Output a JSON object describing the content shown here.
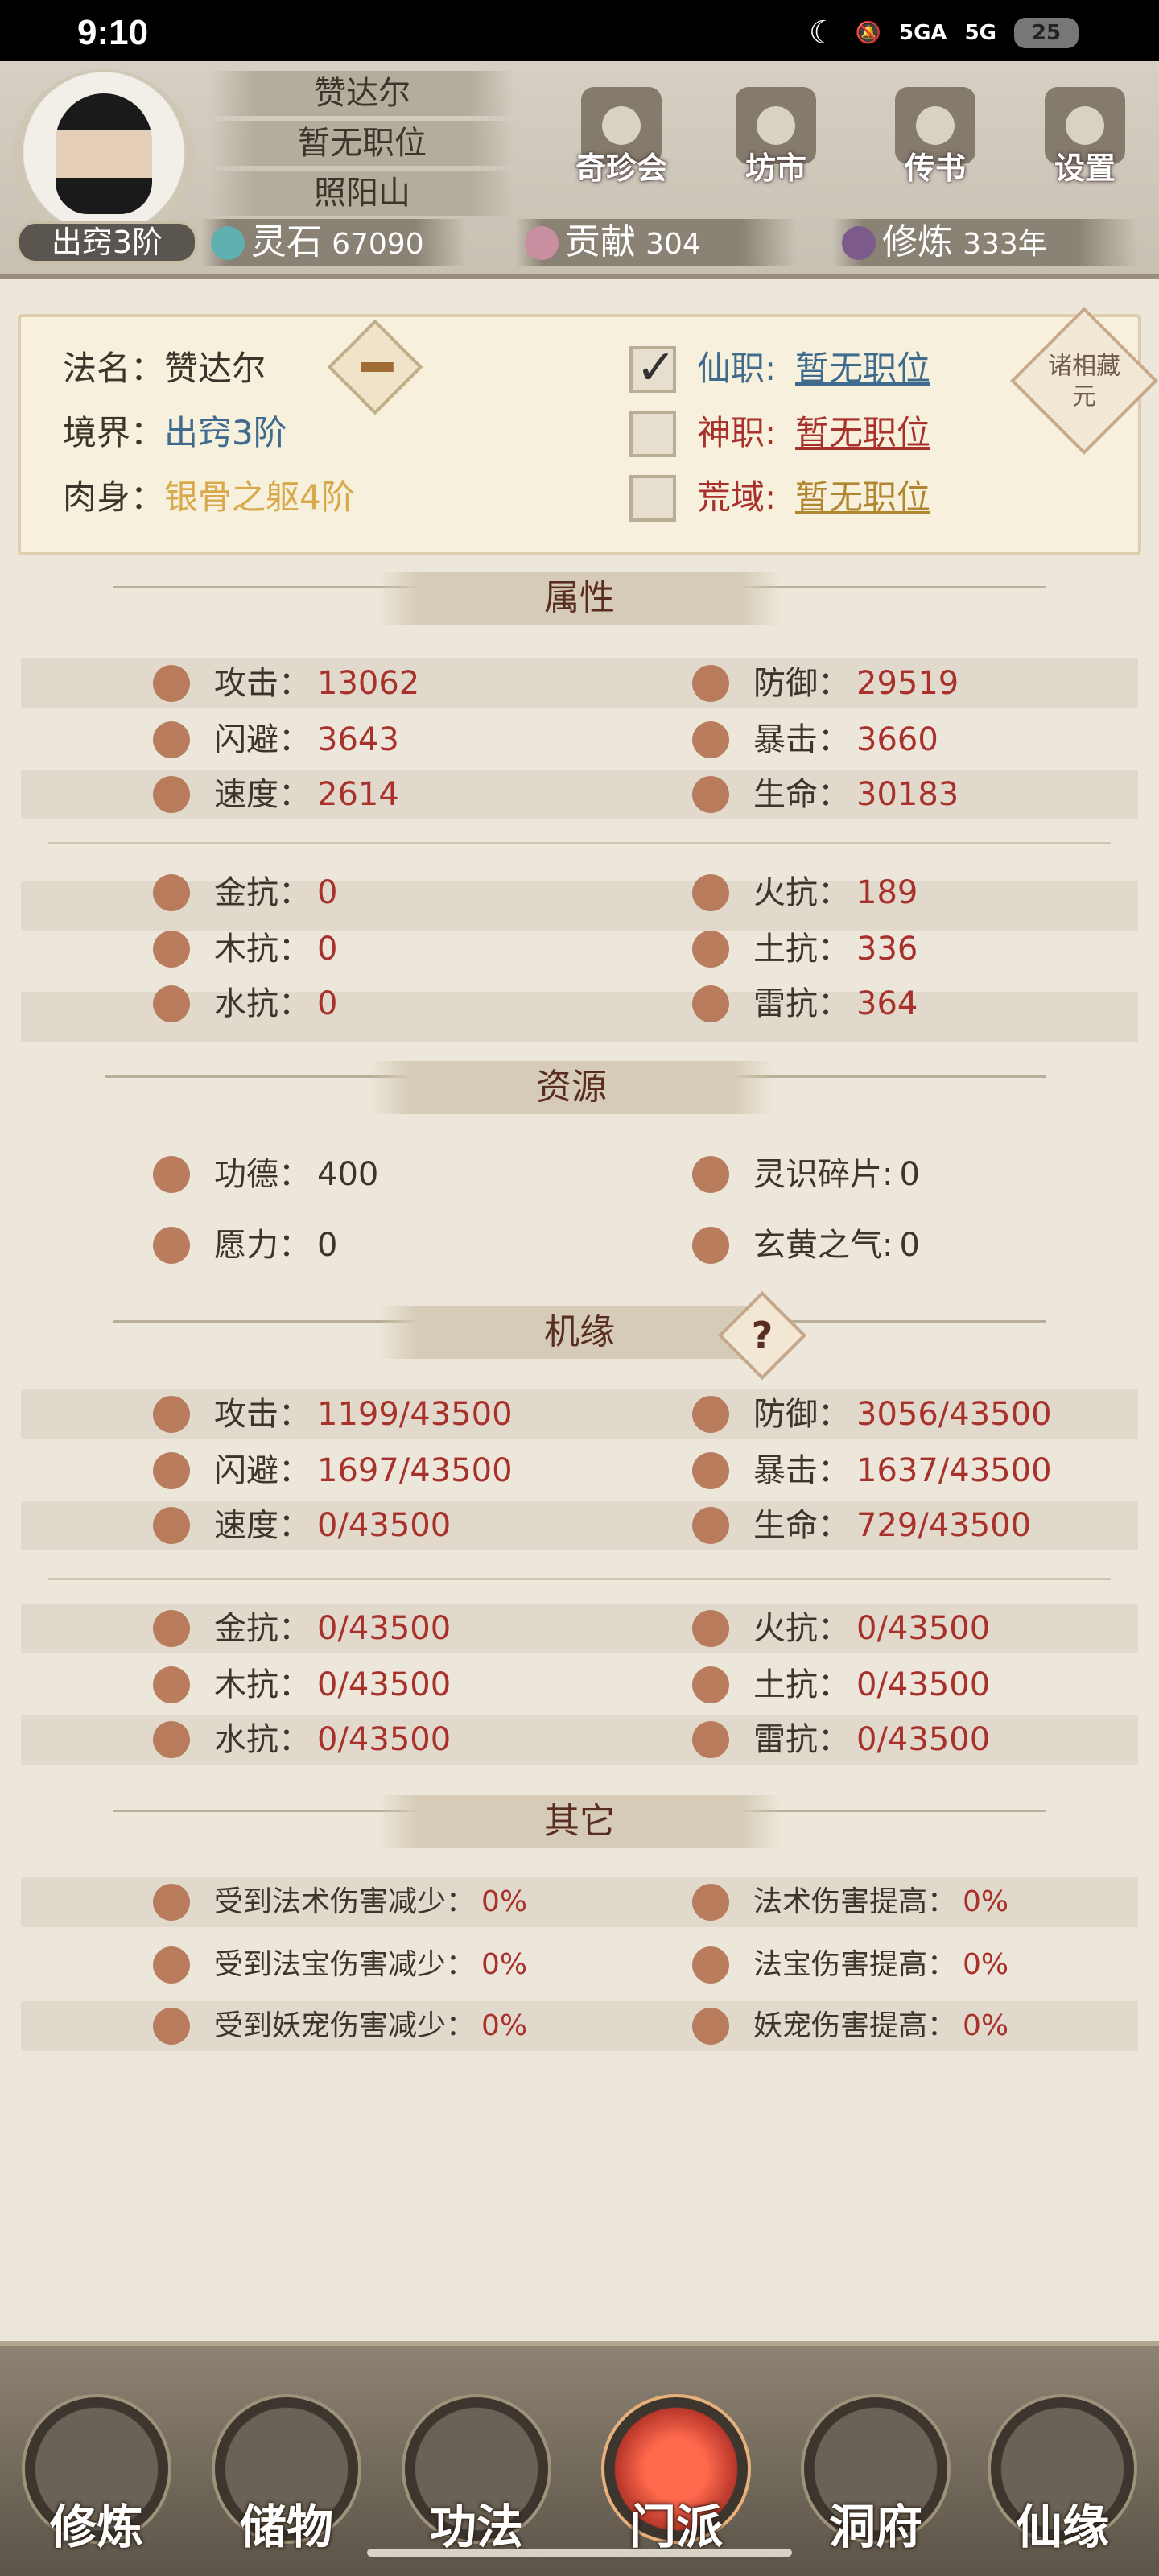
{
  "status_bar": {
    "time": "9:10",
    "network1": "5GA",
    "network2": "5G",
    "battery": "25"
  },
  "header": {
    "name": "赞达尔",
    "position": "暂无职位",
    "location": "照阳山",
    "realm_badge": "出窍3阶",
    "buttons": [
      "奇珍会",
      "坊市",
      "传书",
      "设置"
    ],
    "resources": [
      {
        "label": "灵石",
        "value": "67090",
        "icon": "spirit-stone-icon",
        "color": "#5fb0b0"
      },
      {
        "label": "贡献",
        "value": "304",
        "icon": "contribution-icon",
        "color": "#c98fa0"
      },
      {
        "label": "修炼",
        "value": "333年",
        "icon": "cultivation-icon",
        "color": "#7c5a8a"
      }
    ]
  },
  "info": {
    "dharma_name_label": "法名：",
    "dharma_name": "赞达尔",
    "realm_label": "境界：",
    "realm": "出窍3阶",
    "body_label": "肉身：",
    "body": "银骨之躯4阶",
    "posts": [
      {
        "label": "仙职:",
        "value": "暂无职位",
        "checked": true,
        "color": "#3f6b8d"
      },
      {
        "label": "神职:",
        "value": "暂无职位",
        "checked": false,
        "color": "#a8312b"
      },
      {
        "label": "荒域:",
        "value": "暂无职位",
        "checked": false,
        "color": "#b0862f"
      }
    ],
    "zhuxiang_button": "诸相藏元"
  },
  "sections": {
    "attributes": "属性",
    "resources": "资源",
    "fortune": "机缘",
    "others": "其它",
    "fortune_help": "?"
  },
  "attributes": {
    "attack_label": "攻击：",
    "attack": "13062",
    "defense_label": "防御：",
    "defense": "29519",
    "dodge_label": "闪避：",
    "dodge": "3643",
    "crit_label": "暴击：",
    "crit": "3660",
    "speed_label": "速度：",
    "speed": "2614",
    "life_label": "生命：",
    "life": "30183",
    "metal_label": "金抗：",
    "metal": "0",
    "fire_label": "火抗：",
    "fire": "189",
    "wood_label": "木抗：",
    "wood": "0",
    "earth_label": "土抗：",
    "earth": "336",
    "water_label": "水抗：",
    "water": "0",
    "thunder_label": "雷抗：",
    "thunder": "364"
  },
  "resources": {
    "merit_label": "功德：",
    "merit": "400",
    "shard_label": "灵识碎片:",
    "shard": "0",
    "will_label": "愿力：",
    "will": "0",
    "qi_label": "玄黄之气:",
    "qi": "0"
  },
  "fortune": {
    "attack": "1199/43500",
    "defense": "3056/43500",
    "dodge": "1697/43500",
    "crit": "1637/43500",
    "speed": "0/43500",
    "life": "729/43500",
    "metal": "0/43500",
    "fire": "0/43500",
    "wood": "0/43500",
    "earth": "0/43500",
    "water": "0/43500",
    "thunder": "0/43500"
  },
  "others": {
    "spell_dmg_reduce_label": "受到法术伤害减少：",
    "spell_dmg_reduce": "0%",
    "spell_dmg_up_label": "法术伤害提高：",
    "spell_dmg_up": "0%",
    "treasure_dmg_reduce_label": "受到法宝伤害减少：",
    "treasure_dmg_reduce": "0%",
    "treasure_dmg_up_label": "法宝伤害提高：",
    "treasure_dmg_up": "0%",
    "pet_dmg_reduce_label": "受到妖宠伤害减少：",
    "pet_dmg_reduce": "0%",
    "pet_dmg_up_label": "妖宠伤害提高：",
    "pet_dmg_up": "0%"
  },
  "nav": [
    "修炼",
    "储物",
    "功法",
    "门派",
    "洞府",
    "仙缘"
  ],
  "nav_active": "门派"
}
